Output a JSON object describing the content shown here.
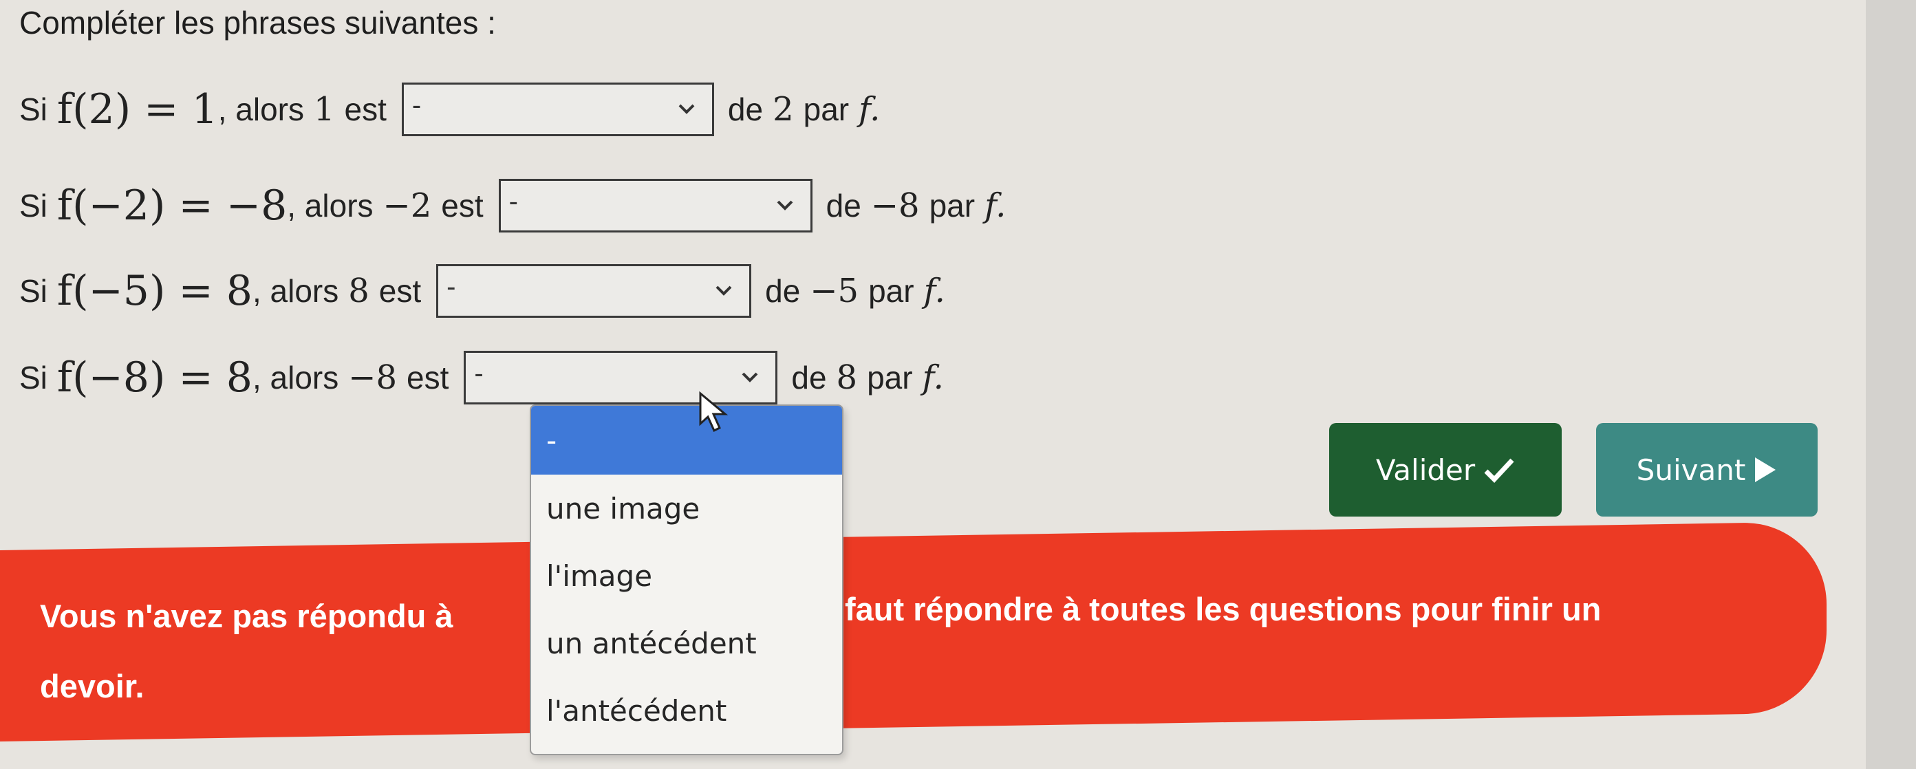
{
  "title": "Compléter les phrases suivantes :",
  "rows": [
    {
      "si": "Si",
      "expr": "f(2) = 1",
      "alors": ", alors",
      "val": "1",
      "est": "est",
      "select_value": "-",
      "de": "de",
      "target": "2",
      "par": "par",
      "f": "f."
    },
    {
      "si": "Si",
      "expr": "f(−2) = −8",
      "alors": ", alors",
      "val": "−2",
      "est": "est",
      "select_value": "-",
      "de": "de",
      "target": "−8",
      "par": "par",
      "f": "f."
    },
    {
      "si": "Si",
      "expr": "f(−5) = 8",
      "alors": ", alors",
      "val": "8",
      "est": "est",
      "select_value": "-",
      "de": "de",
      "target": "−5",
      "par": "par",
      "f": "f."
    },
    {
      "si": "Si",
      "expr": "f(−8) = 8",
      "alors": ", alors",
      "val": "−8",
      "est": "est",
      "select_value": "-",
      "de": "de",
      "target": "8",
      "par": "par",
      "f": "f."
    }
  ],
  "dropdown": {
    "options": [
      "-",
      "une image",
      "l'image",
      "un antécédent",
      "l'antécédent"
    ]
  },
  "buttons": {
    "valider": "Valider",
    "suivant": "Suivant"
  },
  "banner": {
    "part1": "Vous n'avez pas répondu à",
    "part2": "faut répondre à toutes les questions pour finir un",
    "part3": "devoir."
  },
  "colors": {
    "valider_bg": "#1e5e30",
    "suivant_bg": "#3d8a84",
    "banner_bg": "#ec3a24",
    "dropdown_selected": "#3f79d8"
  },
  "icons": {
    "valider": "check-icon",
    "suivant": "play-icon",
    "select": "chevron-down-icon"
  }
}
